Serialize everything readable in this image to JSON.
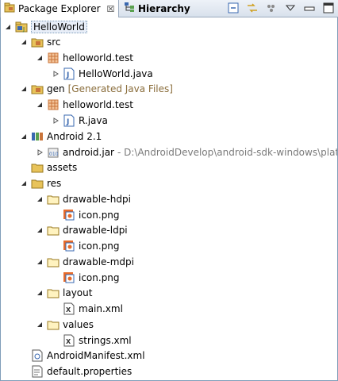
{
  "tabs": [
    {
      "label": "Package Explorer",
      "close": "☒"
    },
    {
      "label": "Hierarchy"
    }
  ],
  "tree": {
    "project": "HelloWorld",
    "src_label": "src",
    "src_pkg": "helloworld.test",
    "src_file": "HelloWorld.java",
    "gen_label": "gen",
    "gen_decoration": "[Generated Java Files]",
    "gen_pkg": "helloworld.test",
    "gen_file": "R.java",
    "android_lib": "Android 2.1",
    "android_jar": "android.jar",
    "android_jar_path": "- D:\\AndroidDevelop\\android-sdk-windows\\platfo",
    "assets": "assets",
    "res": "res",
    "hdpi": "drawable-hdpi",
    "hdpi_icon": "icon.png",
    "ldpi": "drawable-ldpi",
    "ldpi_icon": "icon.png",
    "mdpi": "drawable-mdpi",
    "mdpi_icon": "icon.png",
    "layout": "layout",
    "layout_file": "main.xml",
    "values": "values",
    "values_file": "strings.xml",
    "manifest": "AndroidManifest.xml",
    "props": "default.properties"
  },
  "colors": {
    "folder": "#e8c35a",
    "package": "#c9743a",
    "accent": "#3a68b0"
  }
}
